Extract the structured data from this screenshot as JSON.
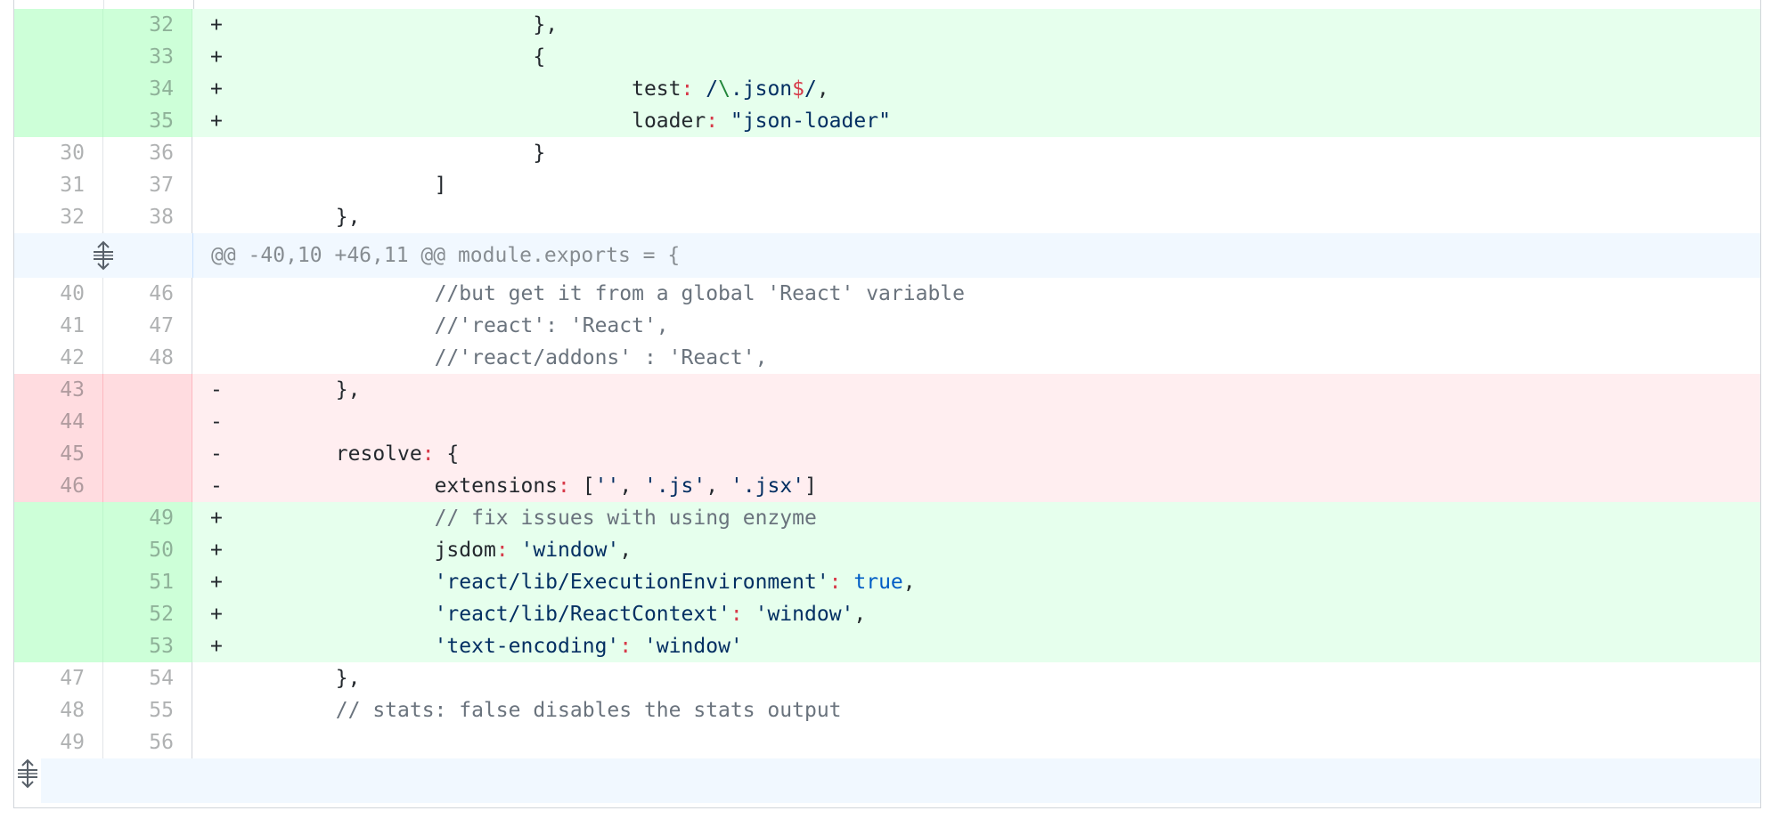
{
  "rows": [
    {
      "type": "add",
      "old": "",
      "new": "32",
      "marker": "+",
      "indent": "                        ",
      "text": "},"
    },
    {
      "type": "add",
      "old": "",
      "new": "33",
      "marker": "+",
      "indent": "                        ",
      "text": "{"
    },
    {
      "type": "add",
      "old": "",
      "new": "34",
      "marker": "+",
      "indent": "                                ",
      "key": "test",
      "sep": ": ",
      "rx1": "/",
      "rxbody": "\\.json",
      "rxdollar": "$",
      "rx2": "/",
      "tail": ","
    },
    {
      "type": "add",
      "old": "",
      "new": "35",
      "marker": "+",
      "indent": "                                ",
      "key": "loader",
      "sep": ": ",
      "str": "\"json-loader\""
    },
    {
      "type": "ctx",
      "old": "30",
      "new": "36",
      "indent": "                        ",
      "text": "}"
    },
    {
      "type": "ctx",
      "old": "31",
      "new": "37",
      "indent": "                ",
      "text": "]"
    },
    {
      "type": "ctx",
      "old": "32",
      "new": "38",
      "indent": "        ",
      "text": "},"
    },
    {
      "type": "hunk",
      "text": "@@ -40,10 +46,11 @@ module.exports = {",
      "icon": "expand-icon"
    },
    {
      "type": "ctx",
      "old": "40",
      "new": "46",
      "indent": "                ",
      "cmt": "//but get it from a global 'React' variable"
    },
    {
      "type": "ctx",
      "old": "41",
      "new": "47",
      "indent": "                ",
      "cmt": "//'react': 'React',"
    },
    {
      "type": "ctx",
      "old": "42",
      "new": "48",
      "indent": "                ",
      "cmt": "//'react/addons' : 'React',"
    },
    {
      "type": "del",
      "old": "43",
      "new": "",
      "marker": "-",
      "indent": "        ",
      "text": "},"
    },
    {
      "type": "del",
      "old": "44",
      "new": "",
      "marker": "-",
      "indent": "",
      "text": ""
    },
    {
      "type": "del",
      "old": "45",
      "new": "",
      "marker": "-",
      "indent": "        ",
      "key": "resolve",
      "sep": ": ",
      "tail": "{"
    },
    {
      "type": "del",
      "old": "46",
      "new": "",
      "marker": "-",
      "indent": "                ",
      "key": "extensions",
      "sep": ": ",
      "arr": [
        "''",
        "'.js'",
        "'.jsx'"
      ]
    },
    {
      "type": "add",
      "old": "",
      "new": "49",
      "marker": "+",
      "indent": "                ",
      "cmt": "// fix issues with using enzyme"
    },
    {
      "type": "add",
      "old": "",
      "new": "50",
      "marker": "+",
      "indent": "                ",
      "key": "jsdom",
      "sep": ": ",
      "str": "'window'",
      "tail": ","
    },
    {
      "type": "add",
      "old": "",
      "new": "51",
      "marker": "+",
      "indent": "                ",
      "skey": "'react/lib/ExecutionEnvironment'",
      "sep": ": ",
      "lit": "true",
      "tail": ","
    },
    {
      "type": "add",
      "old": "",
      "new": "52",
      "marker": "+",
      "indent": "                ",
      "skey": "'react/lib/ReactContext'",
      "sep": ": ",
      "str": "'window'",
      "tail": ","
    },
    {
      "type": "add",
      "old": "",
      "new": "53",
      "marker": "+",
      "indent": "                ",
      "skey": "'text-encoding'",
      "sep": ": ",
      "str": "'window'"
    },
    {
      "type": "ctx",
      "old": "47",
      "new": "54",
      "indent": "        ",
      "text": "},"
    },
    {
      "type": "ctx",
      "old": "48",
      "new": "55",
      "indent": "        ",
      "cmt": "// stats: false disables the stats output"
    },
    {
      "type": "ctx",
      "old": "49",
      "new": "56",
      "indent": "",
      "text": ""
    },
    {
      "type": "tail",
      "icon": "expand-icon"
    }
  ],
  "colors": {
    "added_bg": "#e6ffed",
    "added_num_bg": "#cdffd8",
    "deleted_bg": "#ffeef0",
    "deleted_num_bg": "#ffdce0",
    "hunk_bg": "#f1f8ff",
    "keyword": "#d73a49",
    "string": "#032f62",
    "comment": "#6a737d"
  }
}
